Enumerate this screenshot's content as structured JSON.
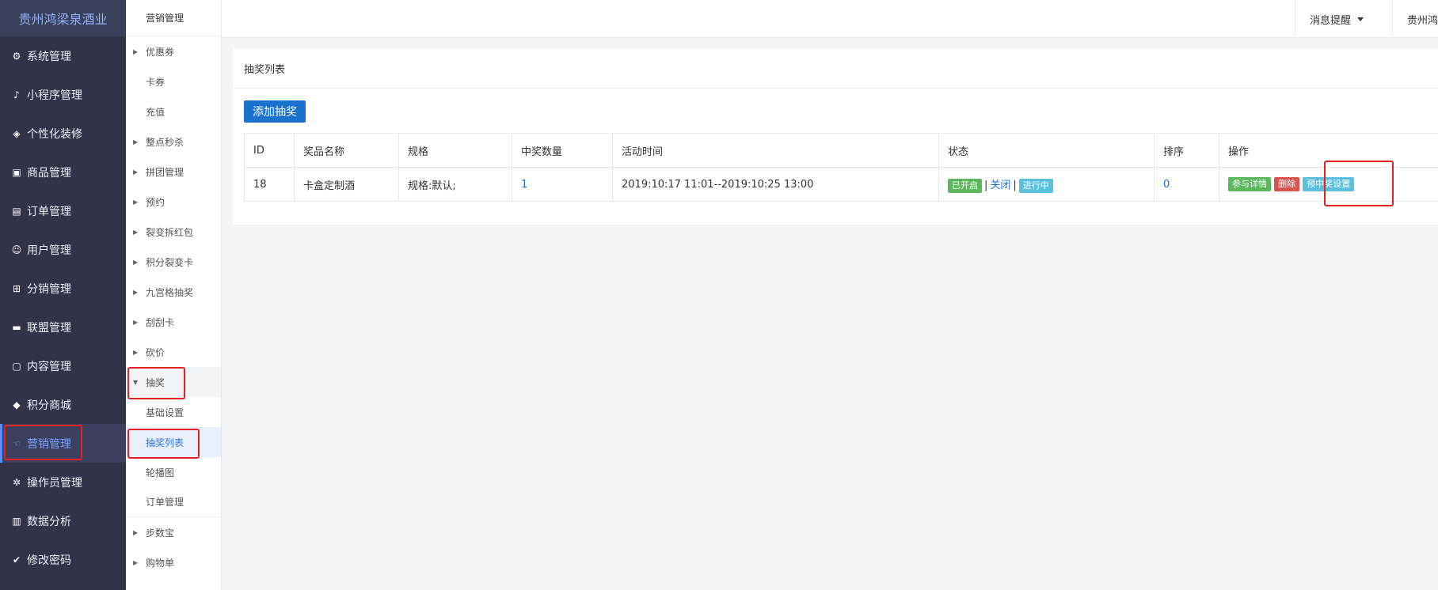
{
  "brand": "贵州鸿梁泉酒业",
  "nav": [
    {
      "label": "系统管理",
      "icon": "gear-outline-icon",
      "glyph": "⚙"
    },
    {
      "label": "小程序管理",
      "icon": "mini-program-icon",
      "glyph": "♪"
    },
    {
      "label": "个性化装修",
      "icon": "layers-icon",
      "glyph": "◈"
    },
    {
      "label": "商品管理",
      "icon": "goods-icon",
      "glyph": "▣"
    },
    {
      "label": "订单管理",
      "icon": "order-icon",
      "glyph": "▤"
    },
    {
      "label": "用户管理",
      "icon": "user-icon",
      "glyph": "☺"
    },
    {
      "label": "分销管理",
      "icon": "distribution-icon",
      "glyph": "⊞"
    },
    {
      "label": "联盟管理",
      "icon": "store-icon",
      "glyph": "▬"
    },
    {
      "label": "内容管理",
      "icon": "content-icon",
      "glyph": "▢"
    },
    {
      "label": "积分商城",
      "icon": "cube-icon",
      "glyph": "◆"
    },
    {
      "label": "营销管理",
      "icon": "marketing-icon",
      "glyph": "☜"
    },
    {
      "label": "操作员管理",
      "icon": "gear-icon",
      "glyph": "✲"
    },
    {
      "label": "数据分析",
      "icon": "bar-chart-icon",
      "glyph": "▥"
    },
    {
      "label": "修改密码",
      "icon": "shield-icon",
      "glyph": "✔"
    }
  ],
  "submenu": {
    "header": "营销管理",
    "items": [
      {
        "label": "优惠券",
        "arrow": true
      },
      {
        "label": "卡券",
        "arrow": false
      },
      {
        "label": "充值",
        "arrow": false
      },
      {
        "label": "整点秒杀",
        "arrow": true
      },
      {
        "label": "拼团管理",
        "arrow": true
      },
      {
        "label": "预约",
        "arrow": true
      },
      {
        "label": "裂变拆红包",
        "arrow": true
      },
      {
        "label": "积分裂变卡",
        "arrow": true
      },
      {
        "label": "九宫格抽奖",
        "arrow": true
      },
      {
        "label": "刮刮卡",
        "arrow": true
      },
      {
        "label": "砍价",
        "arrow": true
      },
      {
        "label": "抽奖",
        "arrow": true
      },
      {
        "label": "基础设置",
        "arrow": false
      },
      {
        "label": "抽奖列表",
        "arrow": false
      },
      {
        "label": "轮播图",
        "arrow": false
      },
      {
        "label": "订单管理",
        "arrow": false
      },
      {
        "label": "步数宝",
        "arrow": true
      },
      {
        "label": "购物单",
        "arrow": true
      }
    ]
  },
  "topbar": {
    "notice": "消息提醒",
    "user": "贵州鸿"
  },
  "panel": {
    "title": "抽奖列表",
    "add_button": "添加抽奖",
    "columns": [
      "ID",
      "奖品名称",
      "规格",
      "中奖数量",
      "活动时间",
      "状态",
      "排序",
      "操作"
    ],
    "rows": [
      {
        "id": "18",
        "name": "卡盒定制酒",
        "spec": "规格:默认;",
        "count": "1",
        "time": "2019:10:17 11:01--2019:10:25 13:00",
        "status_on": "已开启",
        "status_sep": "|",
        "status_close": "关闭",
        "status_running": "进行中",
        "sort": "0",
        "op_detail": "参与详情",
        "op_delete": "删除",
        "op_preset": "预中奖设置"
      }
    ]
  },
  "colors": {
    "sidebar_bg": "#313449",
    "accent": "#1a72cf",
    "highlight": "#e62121",
    "tag_green": "#5cb85c",
    "tag_red": "#d9534f",
    "tag_cyan": "#5bc0de"
  }
}
